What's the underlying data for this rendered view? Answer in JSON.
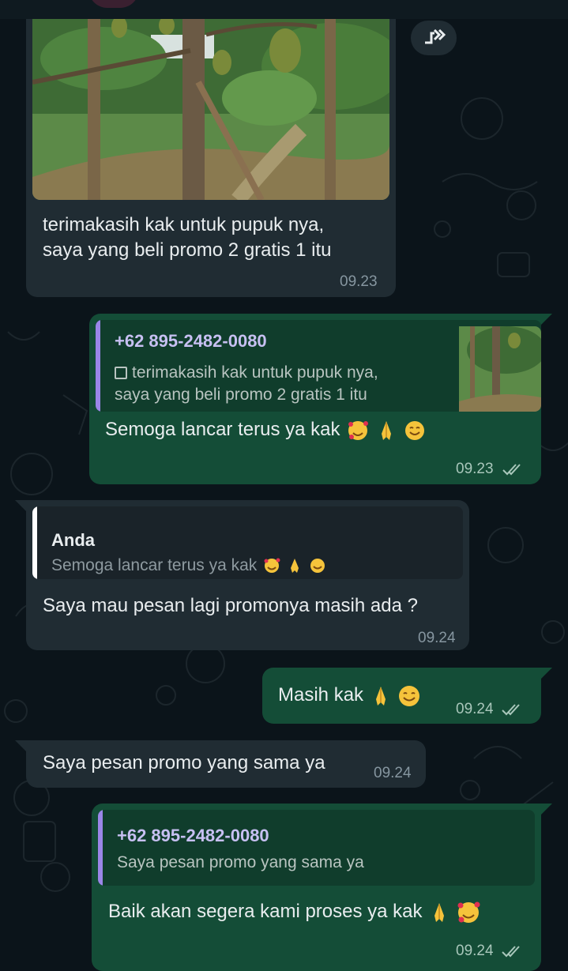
{
  "messages": {
    "m1": {
      "text_line1": "terimakasih kak untuk pupuk nya,",
      "text_line2": "saya yang beli promo 2 gratis 1 itu",
      "time": "09.23"
    },
    "m2": {
      "quote_sender": "+62 895-2482-0080",
      "quote_line1": "terimakasih kak untuk pupuk nya,",
      "quote_line2": "saya yang beli promo 2 gratis 1 itu",
      "text": "Semoga lancar terus ya kak",
      "time": "09.23",
      "status": "read"
    },
    "m3": {
      "quote_sender": "Anda",
      "quote_text": "Semoga lancar terus ya kak",
      "text": "Saya mau pesan lagi promonya masih ada ?",
      "time": "09.24"
    },
    "m4": {
      "text": "Masih kak",
      "time": "09.24",
      "status": "read"
    },
    "m5": {
      "text": "Saya pesan promo yang sama ya",
      "time": "09.24"
    },
    "m6": {
      "quote_sender": "+62 895-2482-0080",
      "quote_text": "Saya pesan promo yang sama ya",
      "text": "Baik akan segera kami proses ya kak",
      "time": "09.24",
      "status": "read"
    }
  },
  "icons": {
    "forward": "forward-icon",
    "read_receipt": "double-check-icon",
    "photo_indicator": "photo-icon",
    "emoji_hearts": "smiling-face-with-hearts",
    "emoji_pray": "folded-hands",
    "emoji_smile": "smiling-face"
  },
  "colors": {
    "background": "#0b141a",
    "incoming_bubble": "#202c33",
    "outgoing_bubble": "#144d37",
    "quote_bar_outgoing": "#9b86e8",
    "quote_bar_incoming": "#ffffff",
    "quote_name_outgoing": "#c7c0f2",
    "read_ticks": "#a9c7bb"
  }
}
